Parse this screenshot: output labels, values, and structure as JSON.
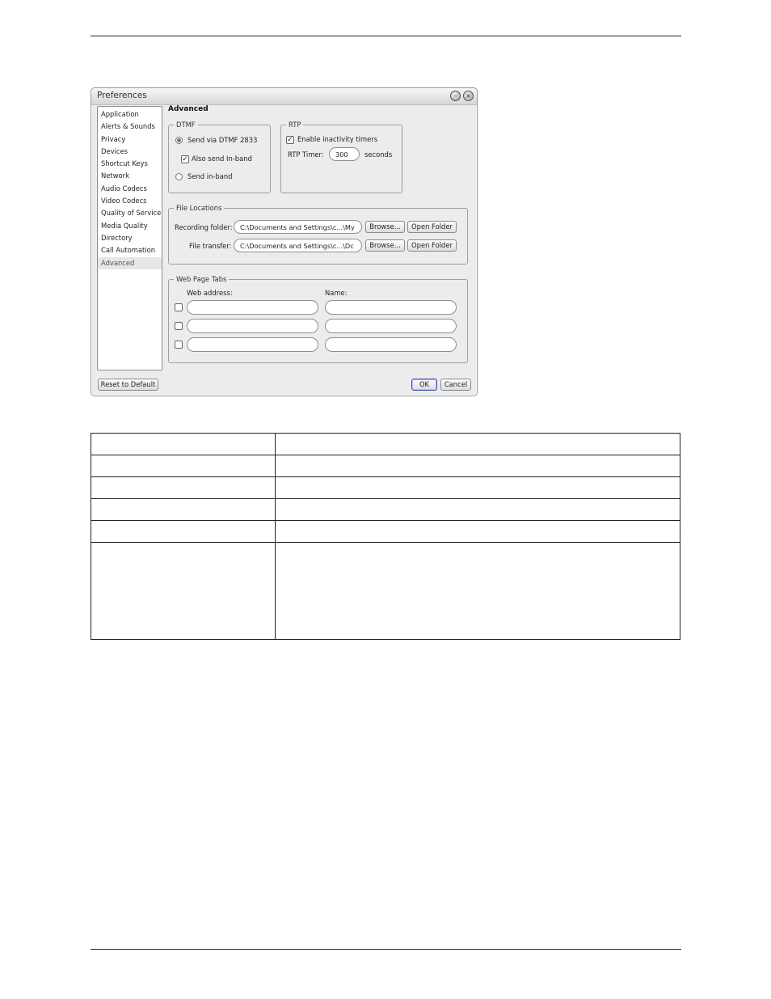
{
  "dialog": {
    "title": "Preferences",
    "minimize_glyph": "–",
    "close_glyph": "×",
    "nav": [
      "Application",
      "Alerts & Sounds",
      "Privacy",
      "Devices",
      "Shortcut Keys",
      "Network",
      "Audio Codecs",
      "Video Codecs",
      "Quality of Service",
      "Media Quality",
      "Directory",
      "Call Automation",
      "Advanced"
    ],
    "selected_nav": "Advanced",
    "panel_title": "Advanced",
    "dtmf": {
      "legend": "DTMF",
      "option_rfc": "Send via DTMF 2833",
      "option_rfc_selected": true,
      "also_inband": "Also send In-band",
      "also_inband_checked": true,
      "option_inband": "Send in-band"
    },
    "rtp": {
      "legend": "RTP",
      "enable_timers": "Enable inactivity timers",
      "enable_timers_checked": true,
      "timer_label": "RTP Timer:",
      "timer_value": "300",
      "timer_unit": "seconds"
    },
    "files": {
      "legend": "File Locations",
      "recording_label": "Recording folder:",
      "recording_value": "C:\\Documents and Settings\\c...\\My",
      "transfer_label": "File transfer:",
      "transfer_value": "C:\\Documents and Settings\\c...\\Dc",
      "browse_label": "Browse...",
      "open_folder_label": "Open Folder"
    },
    "webtabs": {
      "legend": "Web Page Tabs",
      "col_address": "Web address:",
      "col_name": "Name:",
      "rows": [
        {
          "checked": false,
          "address": "",
          "name": ""
        },
        {
          "checked": false,
          "address": "",
          "name": ""
        },
        {
          "checked": false,
          "address": "",
          "name": ""
        }
      ]
    },
    "reset_label": "Reset to Default",
    "ok_label": "OK",
    "cancel_label": "Cancel"
  },
  "table": {
    "rows": [
      [
        "",
        ""
      ],
      [
        "",
        ""
      ],
      [
        "",
        ""
      ],
      [
        "",
        ""
      ],
      [
        "",
        ""
      ],
      [
        "",
        ""
      ]
    ]
  }
}
